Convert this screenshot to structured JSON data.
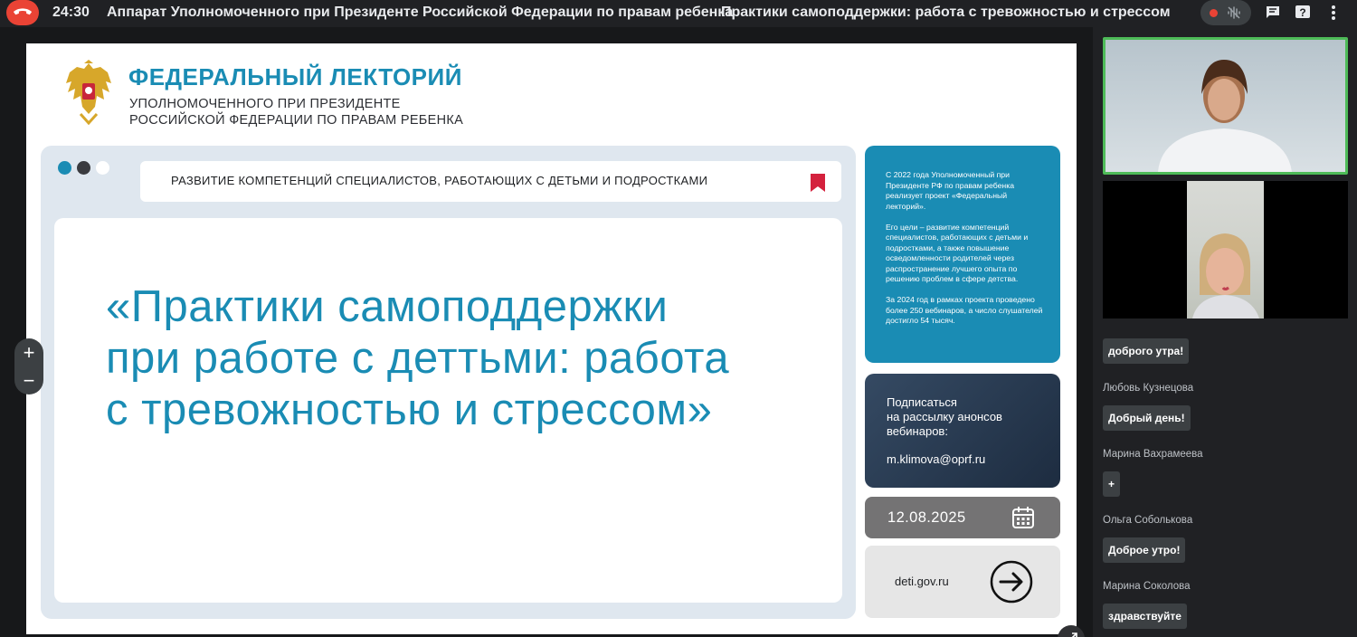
{
  "topbar": {
    "timer": "24:30",
    "meeting_title": "Аппарат Уполномоченного при Президенте Российской Федерации по правам ребенка",
    "topic_title": "Практики самоподдержки: работа с тревожностью и стрессом",
    "icons": [
      "end-call-icon",
      "mic-off-icon",
      "chat-icon",
      "help-icon",
      "more-vert-icon"
    ]
  },
  "slide": {
    "brand_title": "ФЕДЕРАЛЬНЫЙ ЛЕКТОРИЙ",
    "brand_sub_line1": "УПОЛНОМОЧЕННОГО ПРИ ПРЕЗИДЕНТЕ",
    "brand_sub_line2": "РОССИЙСКОЙ ФЕДЕРАЦИИ ПО ПРАВАМ РЕБЕНКА",
    "bookmark_text": "РАЗВИТИЕ КОМПЕТЕНЦИЙ СПЕЦИАЛИСТОВ, РАБОТАЮЩИХ С ДЕТЬМИ И ПОДРОСТКАМИ",
    "title_line1": "«Практики самоподдержки",
    "title_line2": "при работе с деттьми: работа",
    "title_line3": "с тревожностью и стрессом»",
    "info_p1": "С 2022 года Уполномоченный при Президенте РФ по правам ребенка реализует проект «Федеральный лекторий».",
    "info_p2": "Его цели – развитие компетенций специалистов, работающих с детьми и подростками, а также повышение осведомленности родителей через распространение лучшего опыта по решению проблем в сфере детства.",
    "info_p3": "За 2024 год в рамках проекта проведено более 250 вебинаров, а число слушателей достигло 54 тысяч.",
    "subscribe_line1": "Подписаться",
    "subscribe_line2": "на рассылку анонсов",
    "subscribe_line3": "вебинаров:",
    "email": "m.klimova@oprf.ru",
    "date": "12.08.2025",
    "site": "deti.gov.ru",
    "colors": {
      "brand_blue": "#1a8cb4",
      "panel_bg": "#dfe7ef",
      "bookmark_red": "#d4213d"
    }
  },
  "zoom": {
    "plus": "+",
    "minus": "−"
  },
  "chat": [
    {
      "author": "",
      "text": "доброго утра!"
    },
    {
      "author": "Любовь Кузнецова",
      "text": "Добрый день!"
    },
    {
      "author": "Марина Вахрамеева",
      "text": "+"
    },
    {
      "author": "Ольга Собольковa",
      "text": "Доброе утро!"
    },
    {
      "author": "Марина Соколова",
      "text": "здравствуйте"
    }
  ]
}
